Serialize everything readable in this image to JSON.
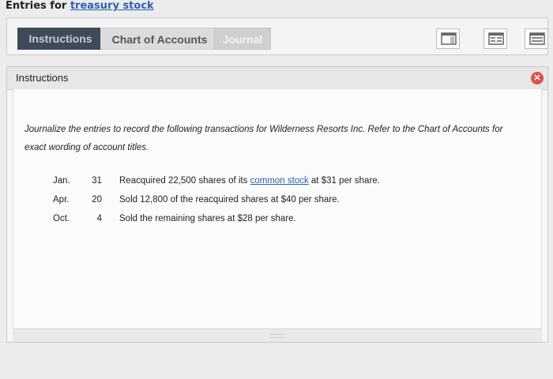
{
  "header": {
    "title_prefix": "Entries for ",
    "title_link": "treasury stock"
  },
  "tabs": [
    {
      "label": "Instructions",
      "active": true
    },
    {
      "label": "Chart of Accounts",
      "active": false
    },
    {
      "label": "Journal",
      "active": false
    }
  ],
  "view_buttons": [
    {
      "icon": "single-panel-view-icon"
    },
    {
      "icon": "split-view-icon"
    },
    {
      "icon": "list-view-icon"
    }
  ],
  "panel": {
    "title": "Instructions",
    "close_icon": "close-icon",
    "intro_line1": "Journalize the entries to record the following transactions for Wilderness Resorts Inc. Refer to the Chart of Accounts for",
    "intro_line2": "exact wording of account titles.",
    "transactions": [
      {
        "month": "Jan.",
        "day": "31",
        "text_before": "Reacquired 22,500 shares of its ",
        "link": "common stock",
        "text_after": " at $31 per share."
      },
      {
        "month": "Apr.",
        "day": "20",
        "text": "Sold 12,800 of the reacquired shares at $40 per share."
      },
      {
        "month": "Oct.",
        "day": "4",
        "text": "Sold the remaining shares at $28 per share."
      }
    ]
  },
  "colors": {
    "active_tab_bg": "#3e4a59",
    "link": "#2d5fb3",
    "close_button": "#d9534f"
  }
}
